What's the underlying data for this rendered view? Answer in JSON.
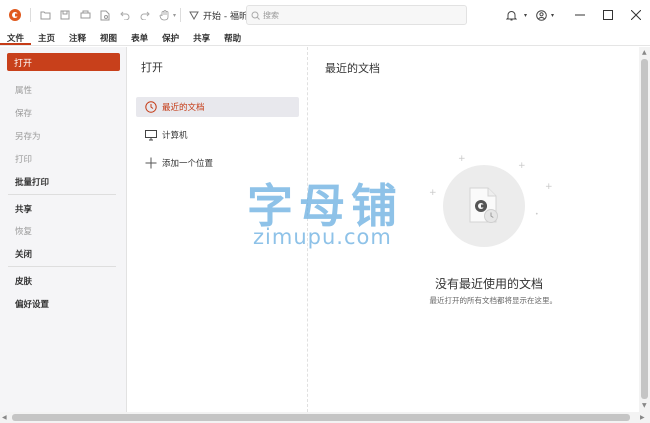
{
  "titlebar": {
    "doc_tab_label": "开始 - 福昕...",
    "search_placeholder": "搜索"
  },
  "menubar": {
    "items": [
      "文件",
      "主页",
      "注释",
      "视图",
      "表单",
      "保护",
      "共享",
      "帮助"
    ]
  },
  "leftpane": {
    "open_label": "打开",
    "items": [
      "属性",
      "保存",
      "另存为",
      "打印",
      "批量打印",
      "共享",
      "恢复",
      "关闭",
      "皮肤",
      "偏好设置"
    ]
  },
  "midpane": {
    "title": "打开",
    "items": [
      "最近的文档",
      "计算机",
      "添加一个位置"
    ]
  },
  "rightpane": {
    "title": "最近的文档",
    "empty_title": "没有最近使用的文档",
    "empty_subtitle": "最近打开的所有文档都将显示在这里。"
  },
  "watermark": {
    "cn": "字母铺",
    "en": "zimupu.com"
  },
  "colors": {
    "accent": "#c8401b",
    "selected_bg": "#e8e8ed",
    "watermark": "#68aee0"
  }
}
